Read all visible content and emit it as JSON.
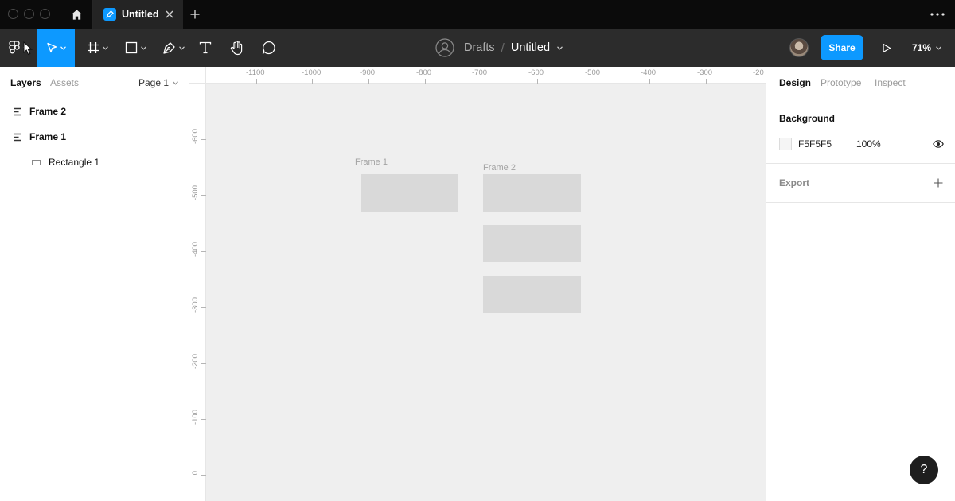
{
  "tabbar": {
    "file_tab_title": "Untitled",
    "icons": [
      "home-icon",
      "figma-file-icon",
      "close-icon",
      "plus-icon",
      "more-horizontal-icon"
    ]
  },
  "toolbar": {
    "tools": [
      "main-menu",
      "move-tool",
      "frame-tool",
      "shape-tool",
      "pen-tool",
      "text-tool",
      "hand-tool",
      "comment-tool"
    ],
    "active_tool": "move-tool",
    "breadcrumb": {
      "project": "Drafts",
      "separator": "/",
      "file": "Untitled"
    },
    "share_label": "Share",
    "zoom": "71%",
    "accent": "#0d99ff"
  },
  "left_panel": {
    "tabs": [
      {
        "label": "Layers",
        "active": true
      },
      {
        "label": "Assets",
        "active": false
      }
    ],
    "page_label": "Page 1",
    "layers": [
      {
        "label": "Frame 2",
        "type": "frame",
        "indent": 0
      },
      {
        "label": "Frame 1",
        "type": "frame",
        "indent": 0
      },
      {
        "label": "Rectangle 1",
        "type": "rectangle",
        "indent": 1
      }
    ]
  },
  "canvas": {
    "background": "#efefef",
    "ruler_top": [
      "-1100",
      "-1000",
      "-900",
      "-800",
      "-700",
      "-600",
      "-500",
      "-400",
      "-300",
      "-20"
    ],
    "ruler_left": [
      "-600",
      "-500",
      "-400",
      "-300",
      "-200",
      "-100",
      "0"
    ],
    "frames": [
      {
        "label": "Frame 1"
      },
      {
        "label": "Frame 2"
      }
    ]
  },
  "right_panel": {
    "tabs": [
      {
        "label": "Design",
        "active": true
      },
      {
        "label": "Prototype",
        "active": false
      },
      {
        "label": "Inspect",
        "active": false
      }
    ],
    "background_title": "Background",
    "background_hex": "F5F5F5",
    "background_opacity": "100%",
    "export_title": "Export",
    "help_label": "?"
  }
}
